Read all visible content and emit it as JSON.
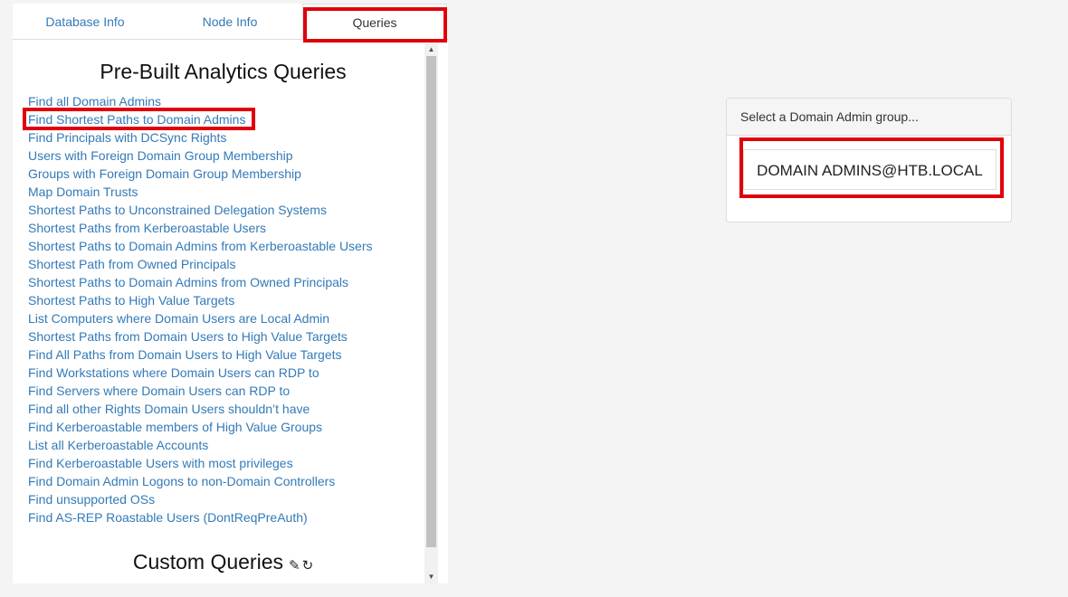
{
  "tabs": [
    "Database Info",
    "Node Info",
    "Queries"
  ],
  "prebuilt_title": "Pre-Built Analytics Queries",
  "queries": [
    "Find all Domain Admins",
    "Find Shortest Paths to Domain Admins",
    "Find Principals with DCSync Rights",
    "Users with Foreign Domain Group Membership",
    "Groups with Foreign Domain Group Membership",
    "Map Domain Trusts",
    "Shortest Paths to Unconstrained Delegation Systems",
    "Shortest Paths from Kerberoastable Users",
    "Shortest Paths to Domain Admins from Kerberoastable Users",
    "Shortest Path from Owned Principals",
    "Shortest Paths to Domain Admins from Owned Principals",
    "Shortest Paths to High Value Targets",
    "List Computers where Domain Users are Local Admin",
    "Shortest Paths from Domain Users to High Value Targets",
    "Find All Paths from Domain Users to High Value Targets",
    "Find Workstations where Domain Users can RDP to",
    "Find Servers where Domain Users can RDP to",
    "Find all other Rights Domain Users shouldn’t have",
    "Find Kerberoastable members of High Value Groups",
    "List all Kerberoastable Accounts",
    "Find Kerberoastable Users with most privileges",
    "Find Domain Admin Logons to non-Domain Controllers",
    "Find unsupported OSs",
    "Find AS-REP Roastable Users (DontReqPreAuth)"
  ],
  "custom_title": "Custom Queries",
  "icons": {
    "edit": "pencil-icon",
    "refresh": "refresh-icon"
  },
  "dialog": {
    "header": "Select a Domain Admin group...",
    "option": "DOMAIN ADMINS@HTB.LOCAL"
  },
  "colors": {
    "link": "#337ab7",
    "highlight": "#e0000b"
  }
}
